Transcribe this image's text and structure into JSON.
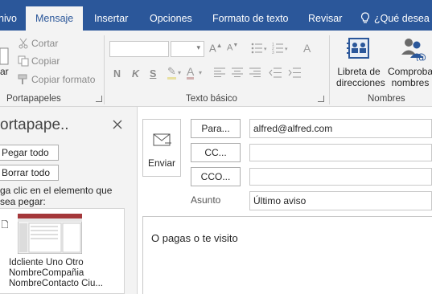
{
  "tabs": [
    {
      "label": "nivo",
      "active": false
    },
    {
      "label": "Mensaje",
      "active": true
    },
    {
      "label": "Insertar",
      "active": false
    },
    {
      "label": "Opciones",
      "active": false
    },
    {
      "label": "Formato de texto",
      "active": false
    },
    {
      "label": "Revisar",
      "active": false
    },
    {
      "label": "¿Qué desea ha",
      "active": false
    }
  ],
  "ribbon": {
    "paste_label": "ar",
    "cut_label": "Cortar",
    "copy_label": "Copiar",
    "format_painter_label": "Copiar formato",
    "clipboard_group": "Portapapeles",
    "basic_text_group": "Texto básico",
    "bold": "N",
    "italic": "K",
    "underline": "S",
    "address_book_line1": "Libreta de",
    "address_book_line2": "direcciones",
    "check_names_line1": "Comproba",
    "check_names_line2": "nombres",
    "names_group": "Nombres"
  },
  "clipboard_pane": {
    "title": "ortapape..",
    "paste_all": "Pegar todo",
    "clear_all": "Borrar todo",
    "hint_line1": "ga clic en el elemento que",
    "hint_line2": "sea pegar:",
    "item_line1": "Idcliente Uno Otro",
    "item_line2": "NombreCompañia",
    "item_line3": "NombreContacto Ciu..."
  },
  "compose": {
    "send": "Enviar",
    "to_button": "Para...",
    "cc_button": "CC...",
    "bcc_button": "CCO...",
    "subject_label": "Asunto",
    "to_value": "alfred@alfred.com",
    "cc_value": "",
    "bcc_value": "",
    "subject_value": "Último aviso",
    "body": "O pagas o te visito"
  },
  "colors": {
    "accent": "#2b579a",
    "ribbon_bg": "#f3f3f3"
  }
}
